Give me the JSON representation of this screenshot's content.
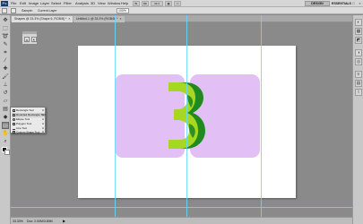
{
  "menubar": {
    "logo": "Ps",
    "items": [
      "File",
      "Edit",
      "Image",
      "Layer",
      "Select",
      "Filter",
      "Analysis",
      "3D",
      "View",
      "Window",
      "Help"
    ],
    "zoom": "33.3",
    "design_button": "DESIGN",
    "workspace": "ESSENTIALS",
    "window_controls": [
      "–",
      "□",
      "×"
    ]
  },
  "optionsbar": {
    "labels": [
      "Sample:",
      "Current Layer"
    ],
    "fields": [
      "100%"
    ]
  },
  "tabs": [
    {
      "label": "Shapes @ 33.3% (Shape 6, RGB/8) *",
      "close": "×"
    },
    {
      "label": "Untitled-1 @ 33.3% (RGB/8) *",
      "close": "×"
    }
  ],
  "toolbar": {
    "tools": [
      "move-icon",
      "marquee-icon",
      "lasso-icon",
      "quick-select-icon",
      "crop-icon",
      "eyedropper-icon",
      "healing-icon",
      "brush-icon",
      "stamp-icon",
      "history-brush-icon",
      "eraser-icon",
      "gradient-icon",
      "blur-icon",
      "dodge-icon",
      "pen-icon",
      "type-icon",
      "path-select-icon",
      "shape-icon",
      "3d-rotate-icon",
      "3d-camera-icon",
      "hand-icon",
      "zoom-icon"
    ]
  },
  "flyout": {
    "items": [
      {
        "label": "Rectangle Tool",
        "key": "U"
      },
      {
        "label": "Rounded Rectangle Tool",
        "key": "U"
      },
      {
        "label": "Ellipse Tool",
        "key": "U"
      },
      {
        "label": "Polygon Tool",
        "key": "U"
      },
      {
        "label": "Line Tool",
        "key": "U"
      },
      {
        "label": "Custom Shape Tool",
        "key": "U"
      }
    ]
  },
  "floatpanel": {
    "buttons": [
      "A",
      "¶"
    ]
  },
  "dock": {
    "icons": [
      "color-icon",
      "swatches-icon",
      "styles-icon",
      "adjustments-icon",
      "masks-icon",
      "layers-icon",
      "channels-icon",
      "paths-icon"
    ]
  },
  "statusbar": {
    "zoom": "33.33%",
    "doc": "Doc: 2.00M/3.80M",
    "arrow": "▶"
  },
  "colors": {
    "card": "#e2bff5",
    "leaf_light": "#a6d821",
    "leaf_dark": "#1f8a1f",
    "guide": "#64d9ff"
  }
}
